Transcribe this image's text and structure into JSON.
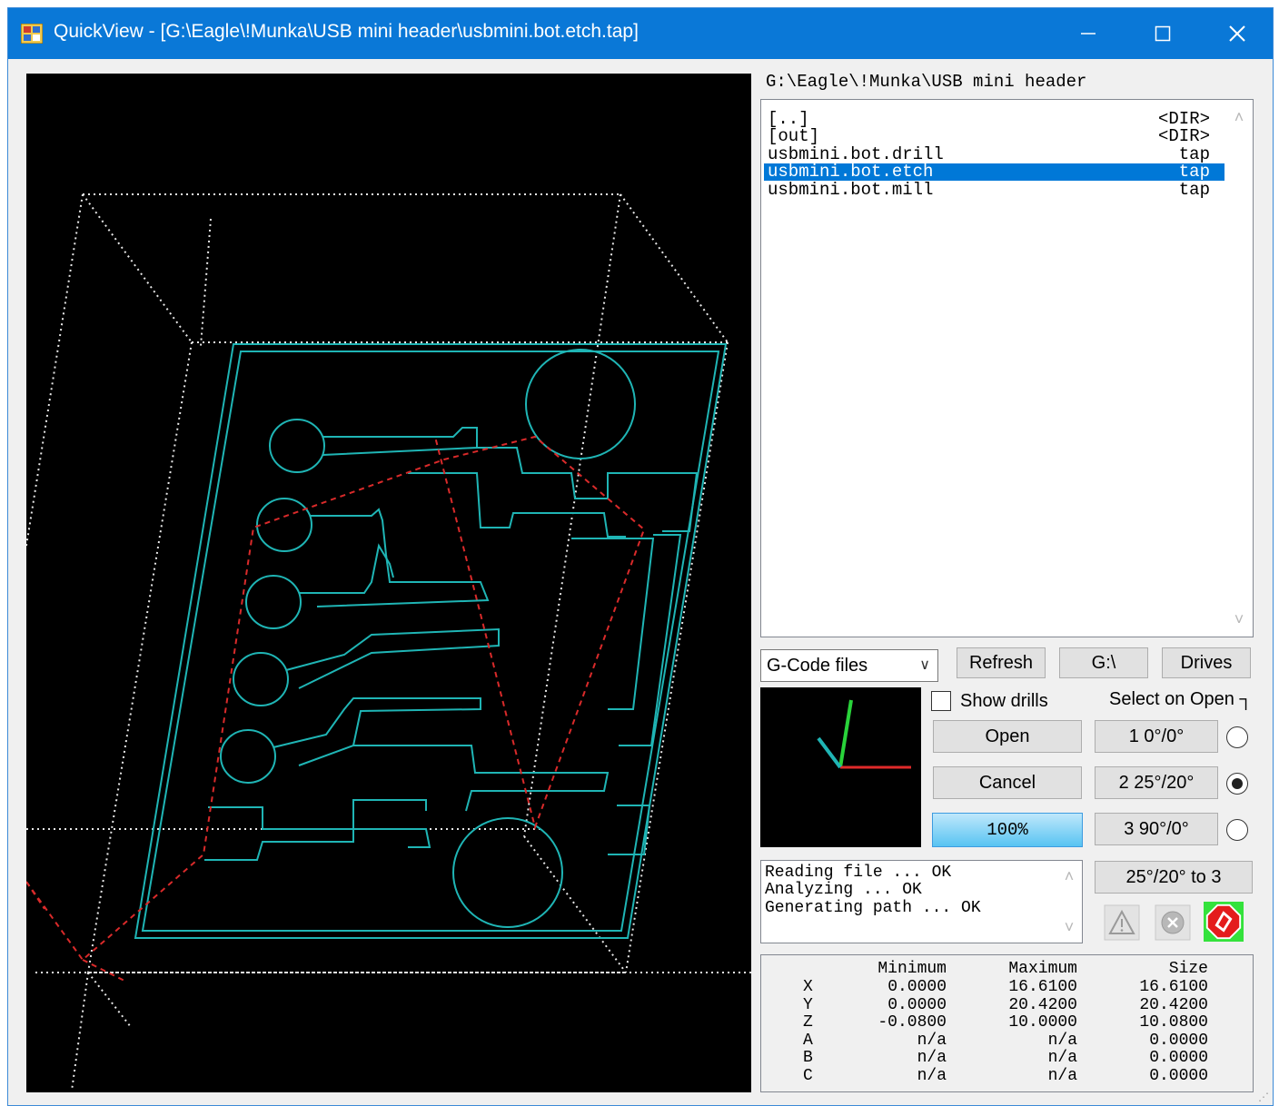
{
  "window": {
    "title": "QuickView - [G:\\Eagle\\!Munka\\USB mini header\\usbmini.bot.etch.tap]",
    "minimize_icon": "minimize-icon",
    "maximize_icon": "maximize-icon",
    "close_icon": "close-icon"
  },
  "browser": {
    "current_path": "G:\\Eagle\\!Munka\\USB mini header",
    "files": [
      {
        "name": "[..]",
        "ext": "<DIR>",
        "selected": false
      },
      {
        "name": "[out]",
        "ext": "<DIR>",
        "selected": false
      },
      {
        "name": "usbmini.bot.drill",
        "ext": "tap",
        "selected": false
      },
      {
        "name": "usbmini.bot.etch",
        "ext": "tap",
        "selected": true
      },
      {
        "name": "usbmini.bot.mill",
        "ext": "tap",
        "selected": false
      }
    ],
    "filter": "G-Code files",
    "refresh_label": "Refresh",
    "drive_label": "G:\\",
    "drives_label": "Drives"
  },
  "controls": {
    "show_drills_label": "Show drills",
    "show_drills_checked": false,
    "select_on_open_label": "Select on Open ┐",
    "open_label": "Open",
    "cancel_label": "Cancel",
    "progress_label": "100%",
    "views": [
      {
        "label": "1 0°/0°",
        "selected": false
      },
      {
        "label": "2 25°/20°",
        "selected": true
      },
      {
        "label": "3 90°/0°",
        "selected": false
      }
    ],
    "copy_view_label": "25°/20° to 3"
  },
  "log": [
    "Reading file ... OK",
    "Analyzing ... OK",
    "Generating path ... OK"
  ],
  "stats": {
    "headers": [
      "Minimum",
      "Maximum",
      "Size"
    ],
    "rows": [
      {
        "axis": "X",
        "min": "0.0000",
        "max": "16.6100",
        "size": "16.6100"
      },
      {
        "axis": "Y",
        "min": "0.0000",
        "max": "20.4200",
        "size": "20.4200"
      },
      {
        "axis": "Z",
        "min": "-0.0800",
        "max": "10.0000",
        "size": "10.0800"
      },
      {
        "axis": "A",
        "min": "n/a",
        "max": "n/a",
        "size": "0.0000"
      },
      {
        "axis": "B",
        "min": "n/a",
        "max": "n/a",
        "size": "0.0000"
      },
      {
        "axis": "C",
        "min": "n/a",
        "max": "n/a",
        "size": "0.0000"
      }
    ]
  },
  "icons": {
    "warning": "warning-icon",
    "stop": "stop-icon",
    "run": "run-icon"
  },
  "colors": {
    "titlebar": "#0a78d7",
    "trace": "#1fb5b5",
    "rapid": "#d92a2a",
    "selection": "#0078d7"
  }
}
